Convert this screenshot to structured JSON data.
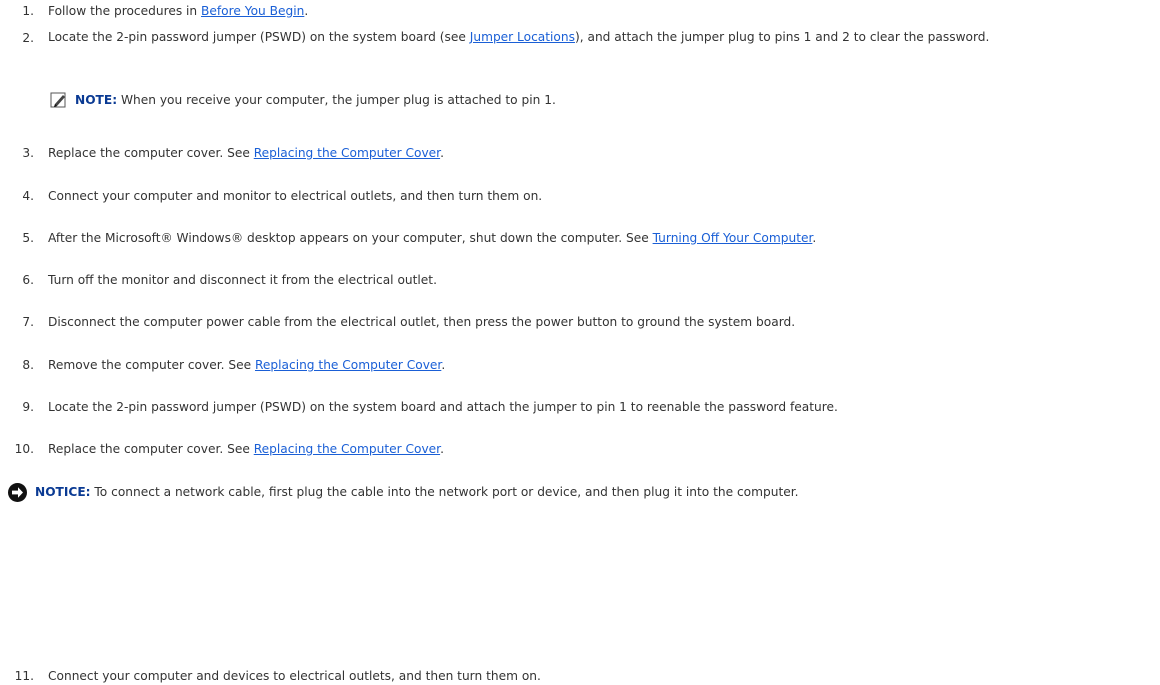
{
  "steps": [
    {
      "num": "1.",
      "pre": "Follow the procedures in ",
      "link": "Before You Begin",
      "post": "."
    },
    {
      "num": "2.",
      "pre": "Locate the 2-pin password jumper (PSWD) on the system board (see ",
      "link": "Jumper Locations",
      "post": "), and attach the jumper plug to pins 1 and 2 to clear the password."
    },
    {
      "num": "3.",
      "pre": "Replace the computer cover. See ",
      "link": "Replacing the Computer Cover",
      "post": "."
    },
    {
      "num": "4.",
      "text": "Connect your computer and monitor to electrical outlets, and then turn them on."
    },
    {
      "num": "5.",
      "pre": "After the Microsoft® Windows® desktop appears on your computer, shut down the computer. See ",
      "link": "Turning Off Your Computer",
      "post": "."
    },
    {
      "num": "6.",
      "text": "Turn off the monitor and disconnect it from the electrical outlet."
    },
    {
      "num": "7.",
      "text": "Disconnect the computer power cable from the electrical outlet, then press the power button to ground the system board."
    },
    {
      "num": "8.",
      "pre": "Remove the computer cover. See ",
      "link": "Replacing the Computer Cover",
      "post": "."
    },
    {
      "num": "9.",
      "text": "Locate the 2-pin password jumper (PSWD) on the system board and attach the jumper to pin 1 to reenable the password feature."
    },
    {
      "num": "10.",
      "pre": "Replace the computer cover. See ",
      "link": "Replacing the Computer Cover",
      "post": "."
    },
    {
      "num": "11.",
      "text": "Connect your computer and devices to electrical outlets, and then turn them on."
    }
  ],
  "note": {
    "label": "NOTE:",
    "text": " When you receive your computer, the jumper plug is attached to pin 1.",
    "icon": "pencil-note-icon"
  },
  "notice": {
    "label": "NOTICE:",
    "text": " To connect a network cable, first plug the cable into the network port or device, and then plug it into the computer.",
    "icon": "notice-arrow-icon"
  },
  "colors": {
    "link": "#1a5fd6",
    "label": "#0a3a93",
    "text": "#333333"
  }
}
